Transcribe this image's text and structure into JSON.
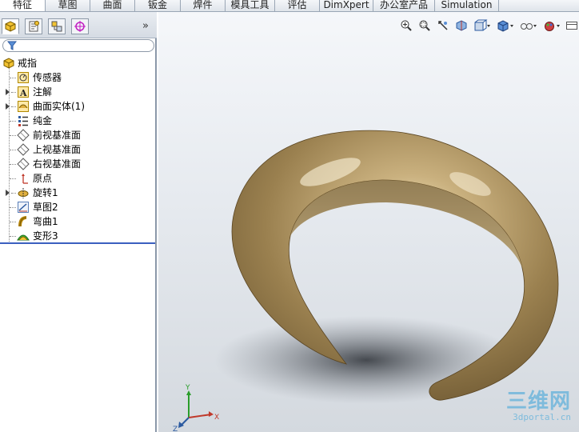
{
  "command_tabs": [
    {
      "label": "特征",
      "active": true
    },
    {
      "label": "草图"
    },
    {
      "label": "曲面"
    },
    {
      "label": "钣金"
    },
    {
      "label": "焊件"
    },
    {
      "label": "模具工具"
    },
    {
      "label": "评估"
    },
    {
      "label": "DimXpert"
    },
    {
      "label": "办公室产品"
    },
    {
      "label": "Simulation"
    }
  ],
  "feature_tree": {
    "root": "戒指",
    "items": [
      {
        "label": "传感器",
        "icon": "sensor-icon"
      },
      {
        "label": "注解",
        "icon": "annotation-icon",
        "expandable": true
      },
      {
        "label": "曲面实体(1)",
        "icon": "surface-bodies-icon",
        "expandable": true
      },
      {
        "label": "纯金",
        "icon": "material-icon"
      },
      {
        "label": "前视基准面",
        "icon": "plane-icon"
      },
      {
        "label": "上视基准面",
        "icon": "plane-icon"
      },
      {
        "label": "右视基准面",
        "icon": "plane-icon"
      },
      {
        "label": "原点",
        "icon": "origin-icon"
      },
      {
        "label": "旋转1",
        "icon": "revolve-icon",
        "expandable": true
      },
      {
        "label": "草图2",
        "icon": "sketch-icon"
      },
      {
        "label": "弯曲1",
        "icon": "flex-icon"
      },
      {
        "label": "变形3",
        "icon": "deform-icon"
      }
    ]
  },
  "panel_tabs": [
    "feature-manager-icon",
    "property-manager-icon",
    "configuration-manager-icon",
    "dimxpert-manager-icon"
  ],
  "triad": {
    "x": "X",
    "y": "Y",
    "z": "Z"
  },
  "watermark": {
    "line1": "三维网",
    "line2": "3dportal.cn"
  },
  "colors": {
    "ring": "#a08a5c",
    "tab_border": "#9aa6b5",
    "rollback_bar": "#3b5fbf"
  }
}
